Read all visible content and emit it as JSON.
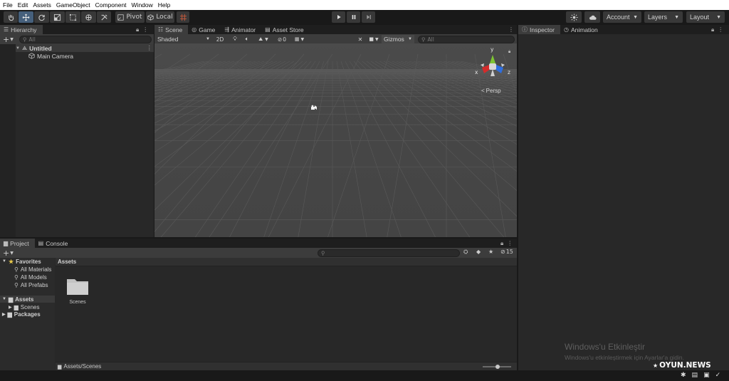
{
  "menu": [
    "File",
    "Edit",
    "Assets",
    "GameObject",
    "Component",
    "Window",
    "Help"
  ],
  "toolbar": {
    "pivot_label": "Pivot",
    "local_label": "Local",
    "account_label": "Account",
    "layers_label": "Layers",
    "layout_label": "Layout"
  },
  "hierarchy": {
    "tab": "Hierarchy",
    "search_placeholder": "All",
    "scene_name": "Untitled",
    "objects": [
      "Main Camera"
    ]
  },
  "scene": {
    "tabs": [
      "Scene",
      "Game",
      "Animator",
      "Asset Store"
    ],
    "shading_mode": "Shaded",
    "mode_2d": "2D",
    "hidden_count": "0",
    "gizmos_label": "Gizmos",
    "search_placeholder": "All",
    "persp_label": "Persp",
    "axis_x": "x",
    "axis_y": "y",
    "axis_z": "z"
  },
  "inspector": {
    "tabs": [
      "Inspector",
      "Animation"
    ]
  },
  "project": {
    "tabs": [
      "Project",
      "Console"
    ],
    "hidden_count": "15",
    "favorites_label": "Favorites",
    "favorites": [
      "All Materials",
      "All Models",
      "All Prefabs"
    ],
    "assets_label": "Assets",
    "assets_children": [
      "Scenes"
    ],
    "packages_label": "Packages",
    "breadcrumb": "Assets",
    "items": [
      {
        "name": "Scenes",
        "type": "folder"
      }
    ],
    "path": "Assets/Scenes"
  },
  "watermark": {
    "title": "Windows'u Etkinleştir",
    "subtitle": "Windows'u etkinleştirmek için Ayarlar'a gidin."
  },
  "logo": "OYUN.NEWS",
  "colors": {
    "window_bg": "#191919",
    "panel_bg": "#282828",
    "tab_active": "#3c3c3c",
    "scene_bg": "#474747",
    "active_tool": "#46607c",
    "gizmo_x": "#d42b2b",
    "gizmo_y": "#7ec433",
    "gizmo_z": "#2f6fe0"
  }
}
